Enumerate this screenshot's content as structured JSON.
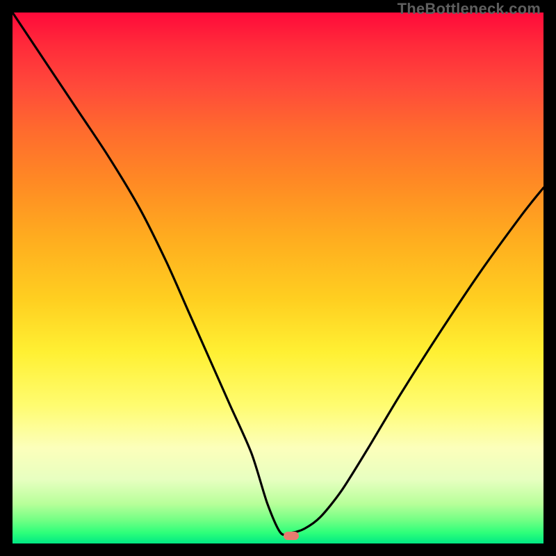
{
  "watermark": "TheBottleneck.com",
  "colors": {
    "curve_stroke": "#000000",
    "marker_fill": "#e77c6f"
  },
  "marker": {
    "x_frac": 0.525,
    "y_frac": 0.985
  },
  "chart_data": {
    "type": "line",
    "title": "",
    "xlabel": "",
    "ylabel": "",
    "xlim": [
      0,
      100
    ],
    "ylim": [
      0,
      100
    ],
    "series": [
      {
        "name": "curve",
        "x": [
          0,
          6,
          12,
          18,
          24,
          29,
          33,
          37,
          41,
          45,
          48,
          50.5,
          52.5,
          55,
          58,
          62,
          67,
          73,
          80,
          88,
          96,
          100
        ],
        "y": [
          100,
          91,
          82,
          73,
          63,
          53,
          44,
          35,
          26,
          17,
          7.5,
          2,
          2,
          2.8,
          5,
          10,
          18,
          28,
          39,
          51,
          62,
          67
        ]
      }
    ]
  }
}
